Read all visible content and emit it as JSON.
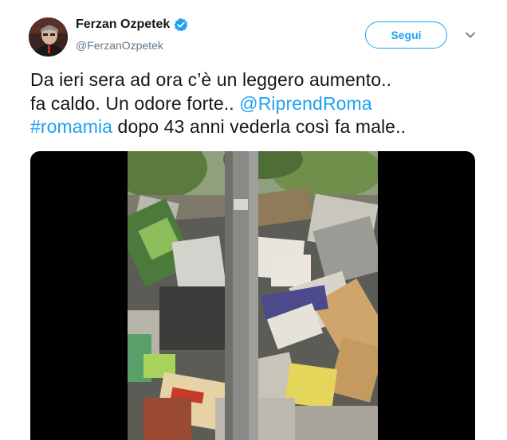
{
  "author": {
    "display_name": "Ferzan Ozpetek",
    "handle": "@FerzanOzpetek",
    "avatar_icon": "avatar-photo",
    "verified_icon": "verified-badge-icon"
  },
  "actions": {
    "follow_label": "Segui",
    "menu_icon": "chevron-down-icon"
  },
  "tweet": {
    "line1": "Da ieri sera ad ora c’è un leggero aumento..",
    "line2_text": "fa caldo.  Un odore forte.. ",
    "mention": "@RiprendRoma",
    "hashtag": "#romamia",
    "line3_text": " dopo 43 anni vederla così fa male.."
  },
  "media": {
    "type": "video",
    "content": "garbage-pile-street-video"
  },
  "colors": {
    "link": "#1da1f2",
    "text": "#14171a",
    "secondary": "#657786"
  }
}
